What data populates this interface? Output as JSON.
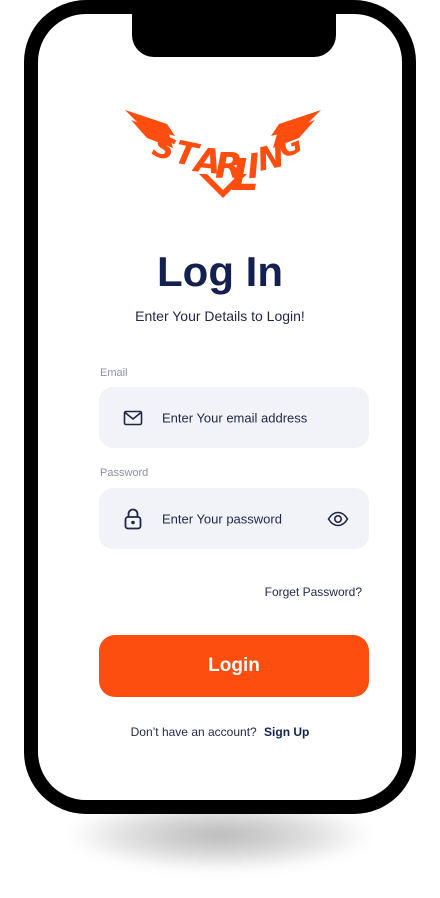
{
  "brand": {
    "logo_text": "STARLING",
    "accent": "#fd4e10",
    "dark": "#14204f"
  },
  "header": {
    "title": "Log In",
    "subtitle": "Enter Your Details to Login!"
  },
  "email": {
    "label": "Email",
    "placeholder": "Enter Your email address",
    "icon": "envelope-icon"
  },
  "password": {
    "label": "Password",
    "placeholder": "Enter Your password",
    "icon": "lock-icon",
    "toggle_icon": "eye-icon"
  },
  "forgot_label": "Forget Password?",
  "login_label": "Login",
  "signup": {
    "prompt": "Don’t have an account?",
    "link_label": "Sign Up"
  }
}
